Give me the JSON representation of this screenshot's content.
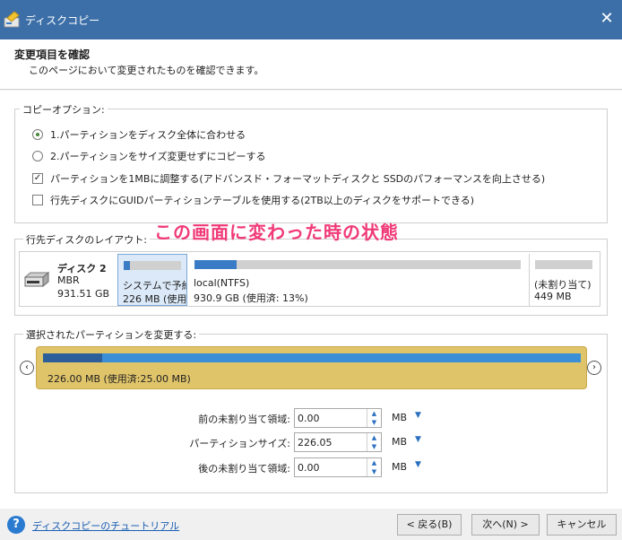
{
  "window": {
    "title": "ディスクコピー",
    "close_glyph": "✕"
  },
  "header": {
    "title": "変更項目を確認",
    "subtitle": "このページにおいて変更されたものを確認できます。"
  },
  "copy_options": {
    "legend": "コピーオプション:",
    "options": [
      {
        "label": "1.パーティションをディスク全体に合わせる",
        "type": "radio",
        "checked": true
      },
      {
        "label": "2.パーティションをサイズ変更せずにコピーする",
        "type": "radio",
        "checked": false
      },
      {
        "label": "パーティションを1MBに調整する(アドバンスド・フォーマットディスクと SSDのパフォーマンスを向上させる)",
        "type": "checkbox",
        "checked": true
      },
      {
        "label": "行先ディスクにGUIDパーティションテーブルを使用する(2TB以上のディスクをサポートできる)",
        "type": "checkbox",
        "checked": false
      }
    ],
    "check_glyph": "✓"
  },
  "annotation": "この画面に変わった時の状態",
  "layout": {
    "legend": "行先ディスクのレイアウト:",
    "disk": {
      "name": "ディスク 2",
      "type": "MBR",
      "size": "931.51 GB"
    },
    "partitions": [
      {
        "name": "システムで予約",
        "size": "226 MB (使用",
        "used_fraction": 0.11,
        "selected": true
      },
      {
        "name": "local(NTFS)",
        "size": "930.9 GB (使用済: 13%)",
        "used_fraction": 0.13,
        "selected": false
      },
      {
        "name": "(未割り当て)",
        "size": "449 MB",
        "used_fraction": 0,
        "selected": false
      }
    ]
  },
  "resize": {
    "legend": "選択されたパーティションを変更する:",
    "label": "226.00 MB (使用済:25.00 MB)",
    "used_fraction": 0.11,
    "left_arrow": "‹",
    "right_arrow": "›",
    "fields": [
      {
        "label": "前の未割り当て領域:",
        "value": "0.00",
        "unit": "MB"
      },
      {
        "label": "パーティションサイズ:",
        "value": "226.05",
        "unit": "MB"
      },
      {
        "label": "後の未割り当て領域:",
        "value": "0.00",
        "unit": "MB"
      }
    ],
    "spin_up": "▲",
    "spin_down": "▼",
    "dropdown_glyph": "▼"
  },
  "footer": {
    "help_glyph": "?",
    "help_link": "ディスクコピーのチュートリアル",
    "back": "< 戻る(B)",
    "next": "次へ(N) >",
    "cancel": "キャンセル"
  },
  "colors": {
    "titlebar": "#3c6fa8",
    "accent": "#3a7bc6",
    "annotation": "#f03a78",
    "resize_panel": "#e0c46a"
  }
}
